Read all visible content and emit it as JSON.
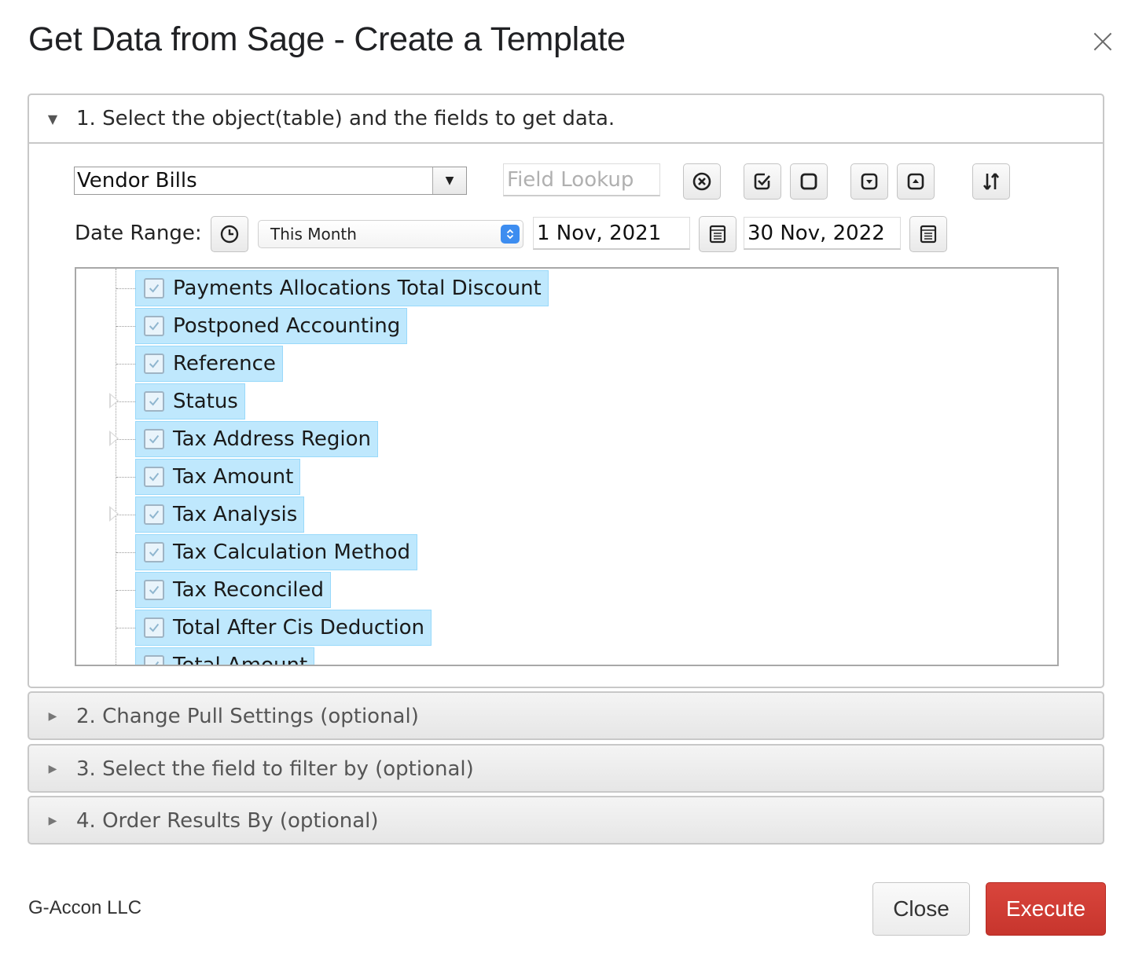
{
  "dialog": {
    "title": "Get Data from Sage - Create a Template",
    "close_icon": "close-icon"
  },
  "section1": {
    "header": "1. Select the object(table) and the fields to get data.",
    "expanded": true,
    "object_select": {
      "value": "Vendor Bills"
    },
    "field_lookup": {
      "placeholder": "Field Lookup",
      "value": ""
    },
    "toolbar_icons": [
      "clear-icon",
      "check-all-icon",
      "uncheck-all-icon",
      "expand-all-icon",
      "collapse-all-icon",
      "sort-icon"
    ],
    "date_range": {
      "label": "Date Range:",
      "preset": "This Month",
      "from": "1 Nov, 2021",
      "to": "30 Nov, 2022"
    },
    "fields": [
      {
        "label": "Payments Allocations Total Discount",
        "checked": true,
        "expandable": false
      },
      {
        "label": "Postponed Accounting",
        "checked": true,
        "expandable": false
      },
      {
        "label": "Reference",
        "checked": true,
        "expandable": false
      },
      {
        "label": "Status",
        "checked": true,
        "expandable": true
      },
      {
        "label": "Tax Address Region",
        "checked": true,
        "expandable": true
      },
      {
        "label": "Tax Amount",
        "checked": true,
        "expandable": false
      },
      {
        "label": "Tax Analysis",
        "checked": true,
        "expandable": true
      },
      {
        "label": "Tax Calculation Method",
        "checked": true,
        "expandable": false
      },
      {
        "label": "Tax Reconciled",
        "checked": true,
        "expandable": false
      },
      {
        "label": "Total After Cis Deduction",
        "checked": true,
        "expandable": false
      },
      {
        "label": "Total Amount",
        "checked": true,
        "expandable": false
      }
    ]
  },
  "section2": {
    "header": "2. Change Pull Settings (optional)"
  },
  "section3": {
    "header": "3. Select the field to filter by (optional)"
  },
  "section4": {
    "header": "4. Order Results By (optional)"
  },
  "footer": {
    "company": "G-Accon LLC",
    "close_label": "Close",
    "execute_label": "Execute"
  },
  "colors": {
    "accent_blue": "#3d8df0",
    "selection_bg": "#bfe8fd",
    "execute_red": "#cf3d35"
  }
}
